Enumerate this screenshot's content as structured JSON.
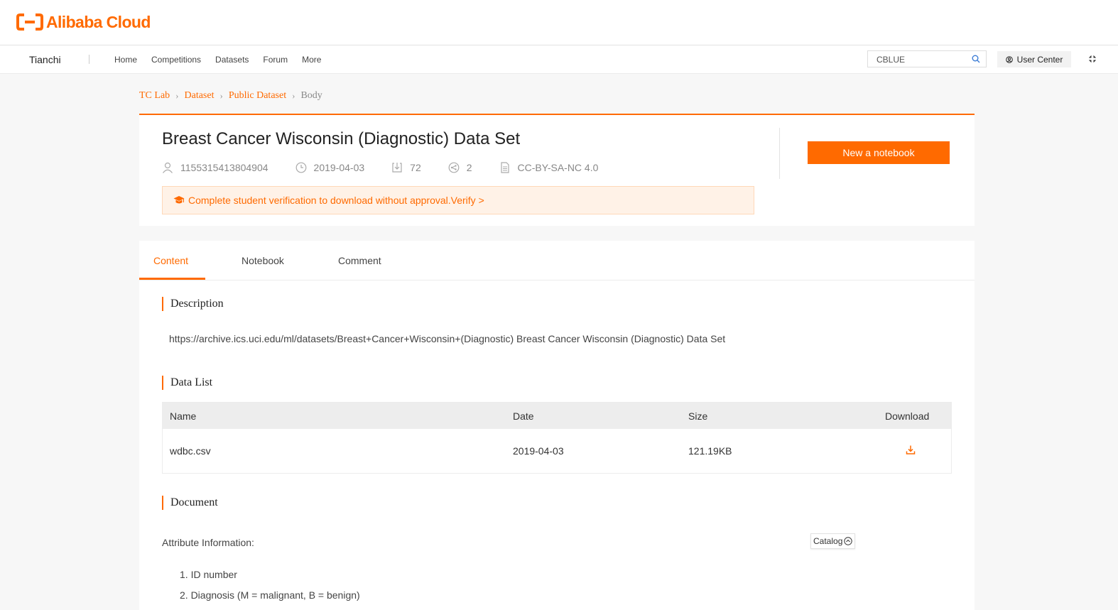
{
  "brand": {
    "logo_text": "Alibaba Cloud",
    "accent_color": "#ff6a00"
  },
  "nav": {
    "brand": "Tianchi",
    "links": [
      "Home",
      "Competitions",
      "Datasets",
      "Forum",
      "More"
    ],
    "search_value": "CBLUE",
    "user_center": "User Center"
  },
  "breadcrumb": [
    "TC Lab",
    "Dataset",
    "Public Dataset",
    "Body"
  ],
  "dataset": {
    "title": "Breast Cancer Wisconsin (Diagnostic) Data Set",
    "meta": {
      "author_id": "1155315413804904",
      "date": "2019-04-03",
      "downloads": "72",
      "shares": "2",
      "license": "CC-BY-SA-NC 4.0"
    },
    "new_notebook": "New a notebook",
    "verify_notice": "Complete student verification to download without approval.Verify >"
  },
  "tabs": [
    "Content",
    "Notebook",
    "Comment"
  ],
  "sections": {
    "description_title": "Description",
    "description_text": "https://archive.ics.uci.edu/ml/datasets/Breast+Cancer+Wisconsin+(Diagnostic) Breast Cancer Wisconsin (Diagnostic) Data Set",
    "datalist_title": "Data List",
    "document_title": "Document"
  },
  "table": {
    "headers": [
      "Name",
      "Date",
      "Size",
      "Download"
    ],
    "rows": [
      {
        "name": "wdbc.csv",
        "date": "2019-04-03",
        "size": "121.19KB"
      }
    ]
  },
  "document": {
    "attr_label": "Attribute Information:",
    "catalog_label": "Catalog",
    "items": [
      "1. ID number",
      "2. Diagnosis (M = malignant, B = benign)"
    ]
  },
  "icons": {
    "search": "search-icon",
    "user": "user-icon",
    "clock": "clock-icon",
    "download": "download-icon",
    "share": "share-icon",
    "license": "document-icon",
    "graduation": "graduation-cap-icon"
  }
}
